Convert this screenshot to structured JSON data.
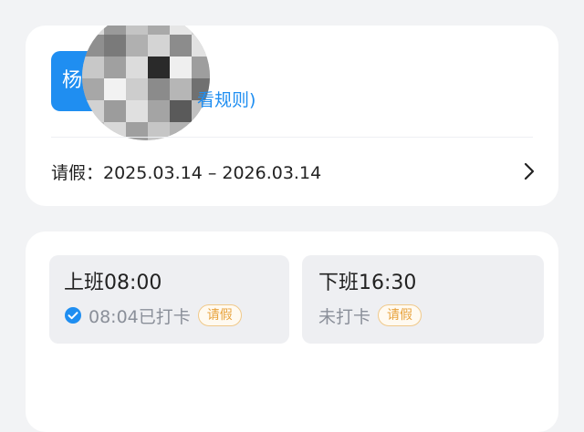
{
  "profile": {
    "avatar_text": "杨",
    "rules_link": "看规则)",
    "leave_period": "请假：2025.03.14 – 2026.03.14"
  },
  "shifts": [
    {
      "title": "上班08:00",
      "status": "08:04已打卡",
      "badge": "请假",
      "checked": true
    },
    {
      "title": "下班16:30",
      "status": "未打卡",
      "badge": "请假",
      "checked": false
    }
  ],
  "colors": {
    "accent": "#1f8ef1",
    "badge_text": "#e8a33d",
    "background": "#f2f3f5"
  },
  "icons": {
    "leave_row": "chevron-right-icon",
    "checked_status": "check-circle-icon"
  }
}
